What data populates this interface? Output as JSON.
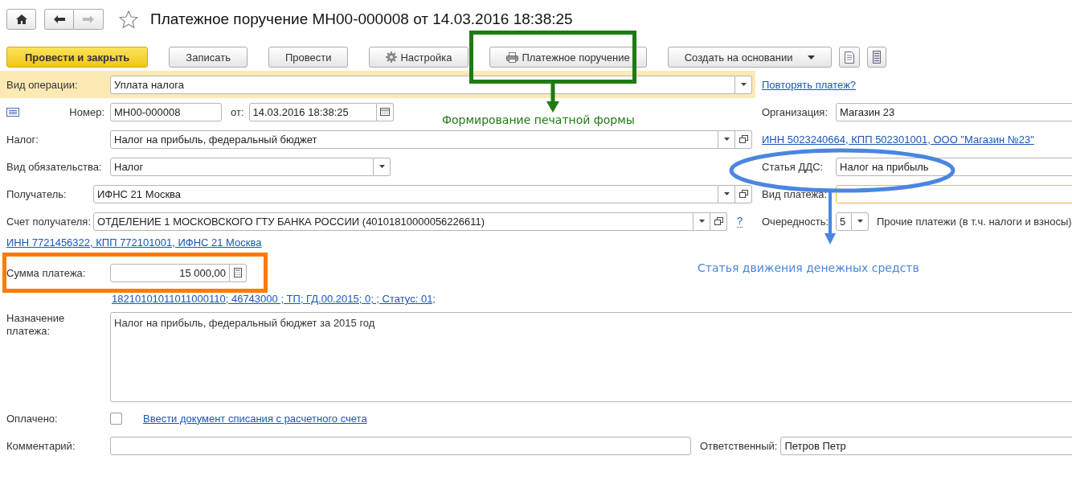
{
  "header": {
    "back_enabled": true,
    "forward_enabled": false,
    "favorite": false,
    "title": "Платежное поручение МН00-000008 от 14.03.2016 18:38:25"
  },
  "toolbar": [
    {
      "label": "Провести и закрыть",
      "kind": "primary"
    },
    {
      "label": "Записать",
      "kind": "plain"
    },
    {
      "label": "Провести",
      "kind": "plain"
    },
    {
      "label": "Настройка",
      "kind": "settings"
    },
    {
      "label": "Платежное поручение",
      "kind": "print"
    },
    {
      "label": "Создать на основании",
      "kind": "menu"
    }
  ],
  "form": {
    "operation": {
      "label": "Вид операции:",
      "value": "Уплата налога",
      "dropdown": true
    },
    "repeat_link": "Повторять платеж?",
    "number": {
      "label": "Номер:",
      "value": "МН00-000008"
    },
    "date": {
      "label": "от:",
      "value": "14.03.2016 18:38:25",
      "calendar": true
    },
    "organization": {
      "label": "Организация:",
      "value": "Магазин 23"
    },
    "tax": {
      "label": "Налог:",
      "value": "Налог на прибыль, федеральный бюджет",
      "dropdown": true,
      "open": true
    },
    "org_details_link": "ИНН 5023240664, КПП 502301001, ООО \"Магазин №23\"",
    "obligation": {
      "label": "Вид обязательства:",
      "value": "Налог",
      "dropdown": true
    },
    "cash_flow_item": {
      "label": "Статья ДДС:",
      "value": "Налог на прибыль"
    },
    "recipient": {
      "label": "Получатель:",
      "value": "ИФНС 21 Москва",
      "dropdown": true,
      "open": true
    },
    "payment_type": {
      "label": "Вид платежа:",
      "highlighted": true
    },
    "recipient_account": {
      "label": "Счет получателя:",
      "value": "ОТДЕЛЕНИЕ 1 МОСКОВСКОГО ГТУ БАНКА РОССИИ (40101810000056226611)",
      "dropdown": true,
      "open": true,
      "help": "?"
    },
    "priority": {
      "label": "Очередность:",
      "value": "5",
      "dropdown": true,
      "description": "Прочие платежи (в т.ч. налоги и взносы)"
    },
    "recipient_details_link": "ИНН 7721456322, КПП 772101001, ИФНС 21 Москва",
    "amount": {
      "label": "Сумма платежа:",
      "value": "15 000,00",
      "calculator": true
    },
    "payment_details_link": "18210101011011000110; 46743000   ; ТП; ГД.00.2015; 0; ; Статус: 01;",
    "purpose": {
      "label": "Назначение платежа:",
      "value": "Налог на прибыль, федеральный бюджет за 2015 год"
    },
    "paid": {
      "label": "Оплачено:",
      "checked": false
    },
    "write_off_link": "Ввести документ списания с расчетного счета",
    "comment": {
      "label": "Комментарий:"
    },
    "responsible": {
      "label": "Ответственный:",
      "value": "Петров Петр"
    }
  },
  "annotations": [
    {
      "kind": "print-form",
      "text": "Формирование печатной формы",
      "color": "#1e7a12"
    },
    {
      "kind": "cash-flow",
      "text": "Статья движения денежных средств",
      "color": "#4a86e0"
    },
    {
      "kind": "amount",
      "color": "#ff7a00"
    }
  ]
}
